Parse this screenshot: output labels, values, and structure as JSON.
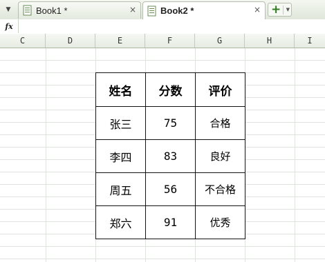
{
  "tabs": [
    {
      "label": "Book1 *",
      "active": false
    },
    {
      "label": "Book2 *",
      "active": true
    }
  ],
  "formula_bar": {
    "fx_label": "fx",
    "value": ""
  },
  "columns": [
    "C",
    "D",
    "E",
    "F",
    "G",
    "H",
    "I"
  ],
  "table": {
    "headers": [
      "姓名",
      "分数",
      "评价"
    ],
    "rows": [
      [
        "张三",
        "75",
        "合格"
      ],
      [
        "李四",
        "83",
        "良好"
      ],
      [
        "周五",
        "56",
        "不合格"
      ],
      [
        "郑六",
        "91",
        "优秀"
      ]
    ]
  },
  "colors": {
    "accent_green": "#2d7d1e",
    "grid_line": "#dfe3dd",
    "header_bg": "#e6ece2"
  }
}
